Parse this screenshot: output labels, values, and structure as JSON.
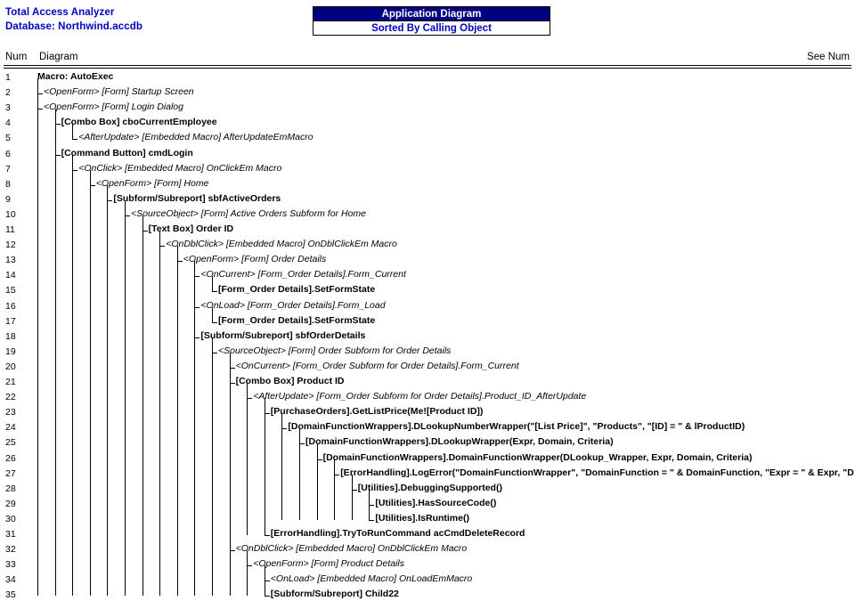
{
  "header": {
    "product_name": "Total Access Analyzer",
    "database_line": "Database: Northwind.accdb",
    "report_title": "Application Diagram",
    "report_subtitle": "Sorted By Calling Object"
  },
  "columns": {
    "num": "Num",
    "diagram": "Diagram",
    "see_num": "See Num"
  },
  "rows": [
    {
      "num": "1",
      "level": 0,
      "style": "bold",
      "text": "Macro: AutoExec"
    },
    {
      "num": "2",
      "level": 1,
      "style": "italic",
      "text": "<OpenForm>  [Form] Startup Screen"
    },
    {
      "num": "3",
      "level": 1,
      "style": "italic",
      "text": "<OpenForm>  [Form] Login Dialog"
    },
    {
      "num": "4",
      "level": 2,
      "style": "bold",
      "text": "[Combo Box] cboCurrentEmployee"
    },
    {
      "num": "5",
      "level": 3,
      "style": "italic",
      "text": "<AfterUpdate>  [Embedded Macro] AfterUpdateEmMacro"
    },
    {
      "num": "6",
      "level": 2,
      "style": "bold",
      "text": "[Command Button] cmdLogin"
    },
    {
      "num": "7",
      "level": 3,
      "style": "italic",
      "text": "<OnClick>  [Embedded Macro] OnClickEm Macro"
    },
    {
      "num": "8",
      "level": 4,
      "style": "italic",
      "text": "<OpenForm>  [Form] Home"
    },
    {
      "num": "9",
      "level": 5,
      "style": "bold",
      "text": "[Subform/Subreport] sbfActiveOrders"
    },
    {
      "num": "10",
      "level": 6,
      "style": "italic",
      "text": "<SourceObject>  [Form] Active Orders Subform for Home"
    },
    {
      "num": "11",
      "level": 7,
      "style": "bold",
      "text": "[Text Box] Order ID"
    },
    {
      "num": "12",
      "level": 8,
      "style": "italic",
      "text": "<OnDblClick>  [Embedded Macro] OnDblClickEm Macro"
    },
    {
      "num": "13",
      "level": 9,
      "style": "italic",
      "text": "<OpenForm>  [Form] Order Details"
    },
    {
      "num": "14",
      "level": 10,
      "style": "italic",
      "text": "<OnCurrent>  [Form_Order Details].Form_Current"
    },
    {
      "num": "15",
      "level": 11,
      "style": "bold",
      "text": "[Form_Order Details].SetFormState"
    },
    {
      "num": "16",
      "level": 10,
      "style": "italic",
      "text": "<OnLoad>  [Form_Order Details].Form_Load"
    },
    {
      "num": "17",
      "level": 11,
      "style": "bold",
      "text": "[Form_Order Details].SetFormState"
    },
    {
      "num": "18",
      "level": 10,
      "style": "bold",
      "text": "[Subform/Subreport] sbfOrderDetails"
    },
    {
      "num": "19",
      "level": 11,
      "style": "italic",
      "text": "<SourceObject>  [Form] Order Subform for Order Details"
    },
    {
      "num": "20",
      "level": 12,
      "style": "italic",
      "text": "<OnCurrent>  [Form_Order Subform for Order Details].Form_Current"
    },
    {
      "num": "21",
      "level": 12,
      "style": "bold",
      "text": "[Combo Box] Product ID"
    },
    {
      "num": "22",
      "level": 13,
      "style": "italic",
      "text": "<AfterUpdate>  [Form_Order Subform for Order Details].Product_ID_AfterUpdate"
    },
    {
      "num": "23",
      "level": 14,
      "style": "bold",
      "text": "[PurchaseOrders].GetListPrice(Me![Product ID])"
    },
    {
      "num": "24",
      "level": 15,
      "style": "bold",
      "text": "[DomainFunctionWrappers].DLookupNumberWrapper(\"[List Price]\", \"Products\", \"[ID] = \" & lProductID)"
    },
    {
      "num": "25",
      "level": 16,
      "style": "bold",
      "text": "[DomainFunctionWrappers].DLookupWrapper(Expr, Domain, Criteria)"
    },
    {
      "num": "26",
      "level": 17,
      "style": "bold",
      "text": "[DomainFunctionWrappers].DomainFunctionWrapper(DLookup_Wrapper, Expr, Domain, Criteria)"
    },
    {
      "num": "27",
      "level": 18,
      "style": "bold",
      "text": "[ErrorHandling].LogError(\"DomainFunctionWrapper\", \"DomainFunction = \" & DomainFunction, \"Expr = \" & Expr, \"D"
    },
    {
      "num": "28",
      "level": 19,
      "style": "bold",
      "text": "[Utilities].DebuggingSupported()"
    },
    {
      "num": "29",
      "level": 20,
      "style": "bold",
      "text": "[Utilities].HasSourceCode()"
    },
    {
      "num": "30",
      "level": 20,
      "style": "bold",
      "text": "[Utilities].IsRuntime()"
    },
    {
      "num": "31",
      "level": 14,
      "style": "bold",
      "text": "[ErrorHandling].TryToRunCommand acCmdDeleteRecord"
    },
    {
      "num": "32",
      "level": 12,
      "style": "italic",
      "text": "<OnDblClick>  [Embedded Macro] OnDblClickEm Macro"
    },
    {
      "num": "33",
      "level": 13,
      "style": "italic",
      "text": "<OpenForm>  [Form] Product Details"
    },
    {
      "num": "34",
      "level": 14,
      "style": "italic",
      "text": "<OnLoad>  [Embedded Macro] OnLoadEmMacro"
    },
    {
      "num": "35",
      "level": 14,
      "style": "bold",
      "text": "[Subform/Subreport] Child22"
    }
  ],
  "tree": {
    "connectors": [
      {
        "row": 1,
        "kind": "tee",
        "level": 1
      },
      {
        "row": 2,
        "kind": "elbow",
        "level": 1
      },
      {
        "row": 3,
        "kind": "tee",
        "level": 2
      },
      {
        "row": 4,
        "kind": "elbow",
        "level": 3
      },
      {
        "row": 5,
        "kind": "elbow",
        "level": 2
      },
      {
        "row": 6,
        "kind": "elbow",
        "level": 3
      },
      {
        "row": 7,
        "kind": "elbow",
        "level": 4
      },
      {
        "row": 8,
        "kind": "tee",
        "level": 5
      },
      {
        "row": 9,
        "kind": "elbow",
        "level": 6
      },
      {
        "row": 10,
        "kind": "tee",
        "level": 7
      },
      {
        "row": 11,
        "kind": "elbow",
        "level": 8
      },
      {
        "row": 12,
        "kind": "elbow",
        "level": 9
      },
      {
        "row": 13,
        "kind": "tee",
        "level": 10
      },
      {
        "row": 14,
        "kind": "elbow",
        "level": 11
      },
      {
        "row": 15,
        "kind": "tee",
        "level": 10
      },
      {
        "row": 16,
        "kind": "elbow",
        "level": 11
      },
      {
        "row": 17,
        "kind": "tee",
        "level": 10
      },
      {
        "row": 18,
        "kind": "elbow",
        "level": 11
      },
      {
        "row": 19,
        "kind": "tee",
        "level": 12
      },
      {
        "row": 20,
        "kind": "tee",
        "level": 12
      },
      {
        "row": 21,
        "kind": "tee",
        "level": 13
      },
      {
        "row": 22,
        "kind": "tee",
        "level": 14
      },
      {
        "row": 23,
        "kind": "elbow",
        "level": 15
      },
      {
        "row": 24,
        "kind": "elbow",
        "level": 16
      },
      {
        "row": 25,
        "kind": "elbow",
        "level": 17
      },
      {
        "row": 26,
        "kind": "elbow",
        "level": 18
      },
      {
        "row": 27,
        "kind": "elbow",
        "level": 19
      },
      {
        "row": 28,
        "kind": "tee",
        "level": 20
      },
      {
        "row": 29,
        "kind": "elbow",
        "level": 20
      },
      {
        "row": 30,
        "kind": "elbow",
        "level": 14
      },
      {
        "row": 31,
        "kind": "tee",
        "level": 12
      },
      {
        "row": 32,
        "kind": "elbow",
        "level": 13
      },
      {
        "row": 33,
        "kind": "tee",
        "level": 14
      },
      {
        "row": 34,
        "kind": "tee",
        "level": 14
      }
    ]
  }
}
